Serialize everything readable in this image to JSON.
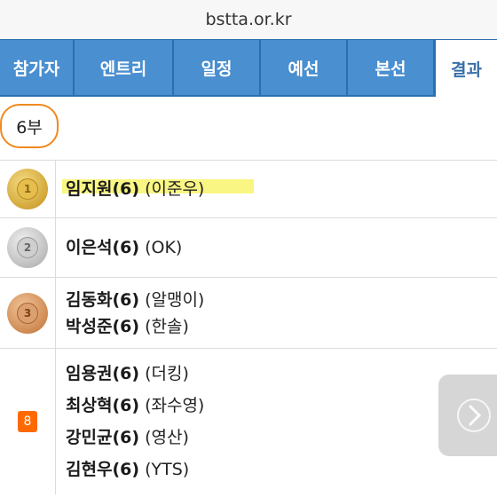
{
  "url": "bstta.or.kr",
  "tabs": [
    {
      "label": "참가자"
    },
    {
      "label": "엔트리"
    },
    {
      "label": "일정"
    },
    {
      "label": "예선"
    },
    {
      "label": "본선"
    },
    {
      "label": "결과"
    }
  ],
  "division": "6부",
  "results": [
    {
      "rank": "1",
      "medal": "gold",
      "players": [
        {
          "name": "임지원(6)",
          "club": "(이준우)"
        }
      ]
    },
    {
      "rank": "2",
      "medal": "silver",
      "players": [
        {
          "name": "이은석(6)",
          "club": "(OK)"
        }
      ]
    },
    {
      "rank": "3",
      "medal": "bronze",
      "players": [
        {
          "name": "김동화(6)",
          "club": "(알맹이)"
        },
        {
          "name": "박성준(6)",
          "club": "(한솔)"
        }
      ]
    },
    {
      "rank": "8",
      "medal": "none",
      "players": [
        {
          "name": "임용권(6)",
          "club": "(더킹)"
        },
        {
          "name": "최상혁(6)",
          "club": "(좌수영)"
        },
        {
          "name": "강민균(6)",
          "club": "(영산)"
        },
        {
          "name": "김현우(6)",
          "club": "(YTS)"
        }
      ]
    }
  ],
  "colors": {
    "tab_bg": "#4a8fd0",
    "tab_border": "#2d6fae",
    "accent_orange": "#f08a1c",
    "rank_badge": "#ff6a00"
  },
  "icons": {
    "next": "chevron-right-icon"
  }
}
